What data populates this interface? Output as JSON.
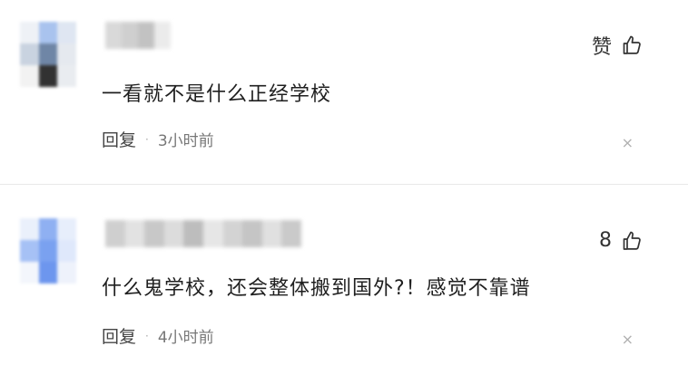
{
  "comments": [
    {
      "text": "一看就不是什么正经学校",
      "reply_label": "回复",
      "separator": "·",
      "time": "3小时前",
      "like_label": "赞",
      "close_symbol": "×"
    },
    {
      "text": "什么鬼学校，还会整体搬到国外?！感觉不靠谱",
      "reply_label": "回复",
      "separator": "·",
      "time": "4小时前",
      "like_label": "8",
      "close_symbol": "×"
    }
  ],
  "colors": {
    "avatar1": [
      "#eef1f6",
      "#a9c3ee",
      "#dfe6f2",
      "#c9d3e0",
      "#6f86a6",
      "#e5e9ef",
      "#f2f2f2",
      "#323232",
      "#e9ecf0"
    ],
    "avatar2": [
      "#eaf0fb",
      "#8fb0f2",
      "#e7eefb",
      "#a6c1f5",
      "#7aa1f0",
      "#dfe8fb",
      "#f3f6fc",
      "#6d96ee",
      "#eef2fb"
    ],
    "name1": [
      "#d9d9d9",
      "#cfcfcf",
      "#c2c2c2",
      "#ebebeb"
    ],
    "name2": [
      "#cfcfcf",
      "#e2e2e2",
      "#c8c8c8",
      "#dcdcdc",
      "#bdbdbd",
      "#e6e6e6",
      "#d3d3d3",
      "#c5c5c5",
      "#e0e0e0",
      "#cacaca"
    ]
  }
}
